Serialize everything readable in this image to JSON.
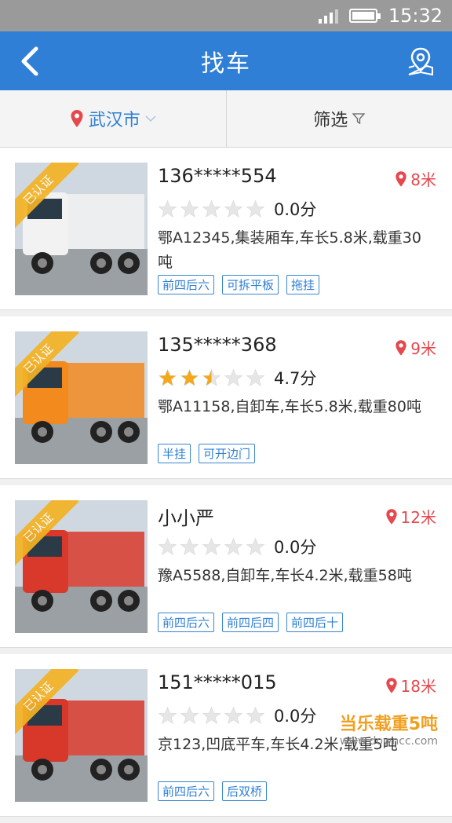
{
  "status_bar": {
    "time": "15:32"
  },
  "app_bar": {
    "title": "找车"
  },
  "filter_bar": {
    "city": "武汉市",
    "filter_label": "筛选"
  },
  "items": [
    {
      "badge": "已认证",
      "name": "136*****554",
      "distance": "8米",
      "rating": 0.0,
      "score": "0.0分",
      "desc": "鄂A12345,集装厢车,车长5.8米,载重30吨",
      "tags": [
        "前四后六",
        "可拆平板",
        "拖挂"
      ],
      "truck_color": "#f2f2f2"
    },
    {
      "badge": "已认证",
      "name": "135*****368",
      "distance": "9米",
      "rating": 2.5,
      "score": "4.7分",
      "desc": "鄂A11158,自卸车,车长5.8米,载重80吨",
      "tags": [
        "半挂",
        "可开边门"
      ],
      "truck_color": "#f28a1e"
    },
    {
      "badge": "已认证",
      "name": "小小严",
      "distance": "12米",
      "rating": 0.0,
      "score": "0.0分",
      "desc": "豫A5588,自卸车,车长4.2米,载重58吨",
      "tags": [
        "前四后六",
        "前四后四",
        "前四后十"
      ],
      "truck_color": "#d9392b"
    },
    {
      "badge": "已认证",
      "name": "151*****015",
      "distance": "18米",
      "rating": 0.0,
      "score": "0.0分",
      "desc": "京123,凹底平车,车长4.2米,载重5吨",
      "tags": [
        "前四后六",
        "后双桥"
      ],
      "truck_color": "#d8382a"
    }
  ],
  "watermark": {
    "line1": "当乐载重5吨",
    "line2": "www.downcc.com"
  }
}
